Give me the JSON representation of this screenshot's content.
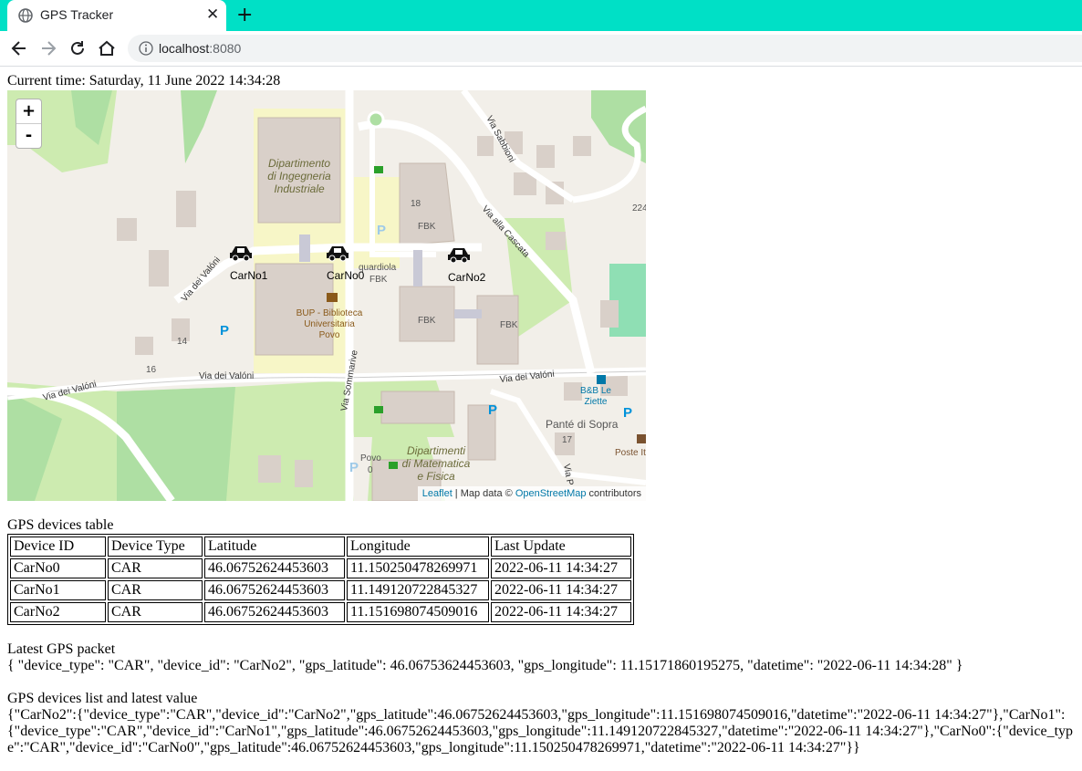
{
  "browser": {
    "tab_title": "GPS Tracker",
    "url_host": "localhost",
    "url_port": ":8080"
  },
  "current_time": "Current time: Saturday, 11 June 2022 14:34:28",
  "map": {
    "zoom_in": "+",
    "zoom_out": "-",
    "attribution": {
      "leaflet": "Leaflet",
      "sep": " | Map data © ",
      "osm": "OpenStreetMap",
      "tail": " contributors"
    },
    "labels": {
      "dii": [
        "Dipartimento",
        "di Ingegneria",
        "Industriale"
      ],
      "bup": [
        "BUP - Biblioteca",
        "Universitaria",
        "Povo"
      ],
      "dmf": [
        "Dipartimenti",
        "di Matematica",
        "e Fisica"
      ],
      "fbk": "FBK",
      "quardiola": "quardiola",
      "via_sabbioni": "Via Sabbioni",
      "via_cascata": "Via alla Cascata",
      "via_valoni": "Via dei Valóni",
      "via_sommarive": "Via Sommarive",
      "bb": [
        "B&B Le",
        "Ziette"
      ],
      "pante": "Panté di Sopra",
      "poste": "Poste It",
      "povo": [
        "Povo",
        "0"
      ],
      "num_18": "18",
      "num_14": "14",
      "num_16": "16",
      "num_17": "17",
      "num_224": "224",
      "via_p": "Via P"
    },
    "markers": [
      {
        "label": "CarNo1"
      },
      {
        "label": "CarNo0"
      },
      {
        "label": "CarNo2"
      }
    ]
  },
  "table": {
    "title": "GPS devices table",
    "headers": [
      "Device ID",
      "Device Type",
      "Latitude",
      "Longitude",
      "Last Update"
    ],
    "rows": [
      [
        "CarNo0",
        "CAR",
        "46.06752624453603",
        "11.150250478269971",
        "2022-06-11 14:34:27"
      ],
      [
        "CarNo1",
        "CAR",
        "46.06752624453603",
        "11.149120722845327",
        "2022-06-11 14:34:27"
      ],
      [
        "CarNo2",
        "CAR",
        "46.06752624453603",
        "11.151698074509016",
        "2022-06-11 14:34:27"
      ]
    ]
  },
  "latest": {
    "title": "Latest GPS packet",
    "value": "{ \"device_type\": \"CAR\", \"device_id\": \"CarNo2\", \"gps_latitude\": 46.06753624453603, \"gps_longitude\": 11.15171860195275, \"datetime\": \"2022-06-11 14:34:28\" }"
  },
  "devices_list": {
    "title": "GPS devices list and latest value",
    "value": "{\"CarNo2\":{\"device_type\":\"CAR\",\"device_id\":\"CarNo2\",\"gps_latitude\":46.06752624453603,\"gps_longitude\":11.151698074509016,\"datetime\":\"2022-06-11 14:34:27\"},\"CarNo1\":{\"device_type\":\"CAR\",\"device_id\":\"CarNo1\",\"gps_latitude\":46.06752624453603,\"gps_longitude\":11.149120722845327,\"datetime\":\"2022-06-11 14:34:27\"},\"CarNo0\":{\"device_type\":\"CAR\",\"device_id\":\"CarNo0\",\"gps_latitude\":46.06752624453603,\"gps_longitude\":11.150250478269971,\"datetime\":\"2022-06-11 14:34:27\"}}"
  },
  "colors": {
    "tabbar": "#00e0c6",
    "map_land": "#f2efe9",
    "park": "#aedfa3",
    "building": "#d9d0c9",
    "road": "#ffffff",
    "link": "#0078a8"
  }
}
